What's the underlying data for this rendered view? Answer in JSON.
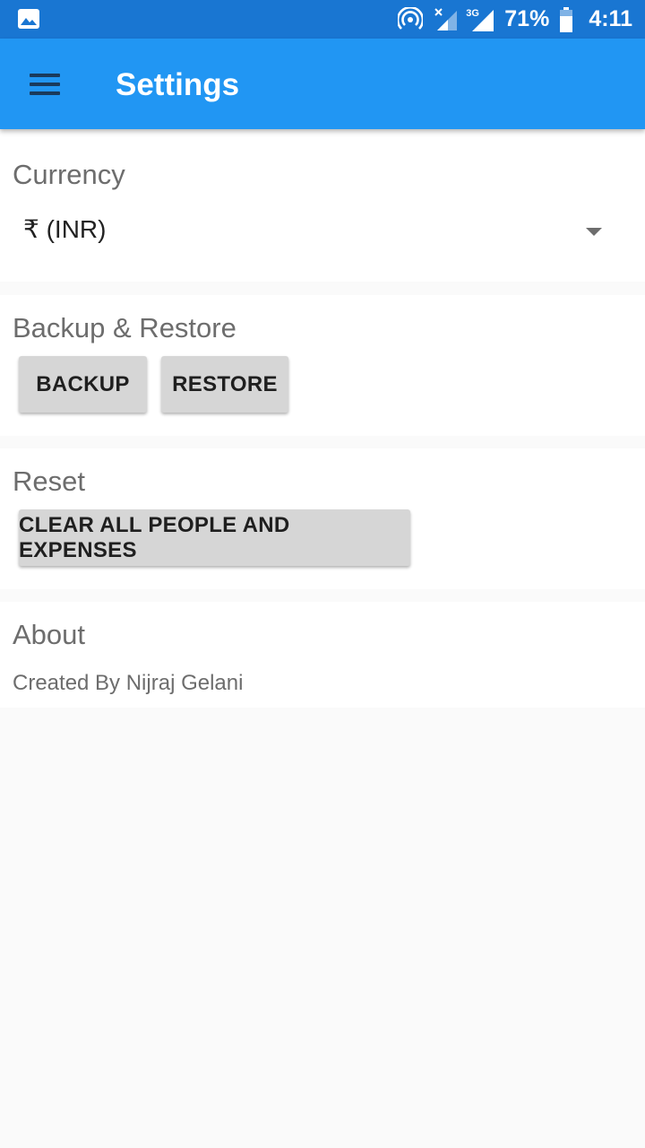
{
  "status_bar": {
    "left_icon": "image-icon",
    "icons": [
      "hotspot-icon",
      "signal-no-data-icon",
      "signal-3g-icon",
      "battery-icon"
    ],
    "network_label": "3G",
    "battery_percent": "71%",
    "time": "4:11"
  },
  "app_bar": {
    "menu_icon": "hamburger-menu-icon",
    "title": "Settings"
  },
  "currency": {
    "title": "Currency",
    "selected": "₹ (INR)",
    "dropdown_icon": "dropdown-arrow-icon"
  },
  "backup_restore": {
    "title": "Backup & Restore",
    "backup_label": "BACKUP",
    "restore_label": "RESTORE"
  },
  "reset": {
    "title": "Reset",
    "clear_label": "CLEAR ALL PEOPLE AND EXPENSES"
  },
  "about": {
    "title": "About",
    "text": "Created By Nijraj Gelani"
  },
  "colors": {
    "status_bar": "#1976d2",
    "app_bar": "#2196f3",
    "button": "#d6d6d6",
    "background": "#fafafa"
  }
}
